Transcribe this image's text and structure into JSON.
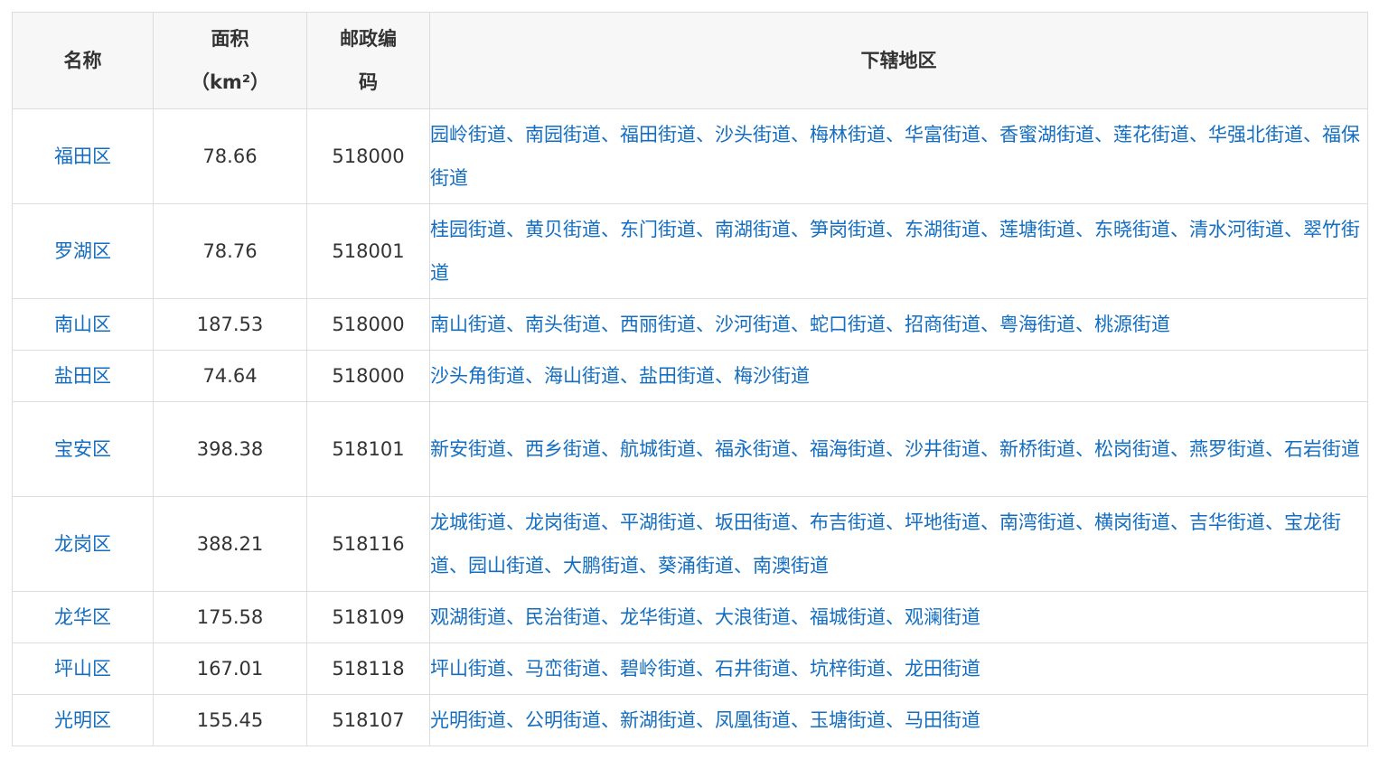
{
  "header": {
    "name": "名称",
    "area_line1": "面积",
    "area_line2": "（km²）",
    "postcode_line1": "邮政编",
    "postcode_line2": "码",
    "subdistricts": "下辖地区"
  },
  "rows": [
    {
      "name": "福田区",
      "area": "78.66",
      "postcode": "518000",
      "subdistricts": "园岭街道、南园街道、福田街道、沙头街道、梅林街道、华富街道、香蜜湖街道、莲花街道、华强北街道、福保街道"
    },
    {
      "name": "罗湖区",
      "area": "78.76",
      "postcode": "518001",
      "subdistricts": "桂园街道、黄贝街道、东门街道、南湖街道、笋岗街道、东湖街道、莲塘街道、东晓街道、清水河街道、翠竹街道"
    },
    {
      "name": "南山区",
      "area": "187.53",
      "postcode": "518000",
      "subdistricts": "南山街道、南头街道、西丽街道、沙河街道、蛇口街道、招商街道、粤海街道、桃源街道"
    },
    {
      "name": "盐田区",
      "area": "74.64",
      "postcode": "518000",
      "subdistricts": "沙头角街道、海山街道、盐田街道、梅沙街道"
    },
    {
      "name": "宝安区",
      "area": "398.38",
      "postcode": "518101",
      "subdistricts": "新安街道、西乡街道、航城街道、福永街道、福海街道、沙井街道、新桥街道、松岗街道、燕罗街道、石岩街道"
    },
    {
      "name": "龙岗区",
      "area": "388.21",
      "postcode": "518116",
      "subdistricts": "龙城街道、龙岗街道、平湖街道、坂田街道、布吉街道、坪地街道、南湾街道、横岗街道、吉华街道、宝龙街道、园山街道、大鹏街道、葵涌街道、南澳街道"
    },
    {
      "name": "龙华区",
      "area": "175.58",
      "postcode": "518109",
      "subdistricts": "观湖街道、民治街道、龙华街道、大浪街道、福城街道、观澜街道"
    },
    {
      "name": "坪山区",
      "area": "167.01",
      "postcode": "518118",
      "subdistricts": "坪山街道、马峦街道、碧岭街道、石井街道、坑梓街道、龙田街道"
    },
    {
      "name": "光明区",
      "area": "155.45",
      "postcode": "518107",
      "subdistricts": "光明街道、公明街道、新湖街道、凤凰街道、玉塘街道、马田街道"
    }
  ]
}
